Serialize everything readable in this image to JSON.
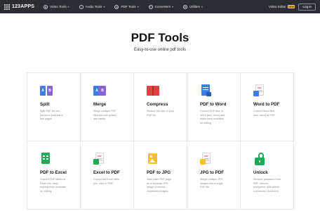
{
  "header": {
    "logo_text": "123APPS",
    "nav": [
      {
        "label": "Video Tools",
        "icon": "play-icon"
      },
      {
        "label": "Audio Tools",
        "icon": "music-icon"
      },
      {
        "label": "PDF Tools",
        "icon": "pdf-icon"
      },
      {
        "label": "Converters",
        "icon": "convert-icon"
      },
      {
        "label": "Utilities",
        "icon": "gear-icon"
      }
    ],
    "video_editor": "Video Editor",
    "new_badge": "NEW",
    "login": "Log in",
    "colors": {
      "bar": "#2b2d33",
      "badge": "#f4c531"
    }
  },
  "page": {
    "title": "PDF Tools",
    "subtitle": "Easy-to-use online pdf tools"
  },
  "tools": [
    {
      "name": "Split",
      "desc": "Split PDF file into pieces or pick just a few pages",
      "icon": "split-icon"
    },
    {
      "name": "Merge",
      "desc": "Merge multiple PDF files into one quickly and easily",
      "icon": "merge-icon"
    },
    {
      "name": "Compress",
      "desc": "Reduce the size of your PDF file",
      "icon": "compress-icon"
    },
    {
      "name": "PDF to Word",
      "desc": "Convert PDF files to Word (doc, docx) and make them available for editing",
      "icon": "pdf-to-word-icon"
    },
    {
      "name": "Word to PDF",
      "desc": "Convert Word files (doc, docx) to PDF",
      "icon": "word-to-pdf-icon"
    },
    {
      "name": "PDF to Excel",
      "desc": "Convert PDF tables to Excel (xls, xlsx), making them available for editing",
      "icon": "pdf-to-excel-icon"
    },
    {
      "name": "Excel to PDF",
      "desc": "Convert an Excel table (xls, xlsx) to PDF",
      "icon": "excel-to-pdf-icon"
    },
    {
      "name": "PDF to JPG",
      "desc": "Save each PDF page as a separate JPG image or extract embedded images",
      "icon": "pdf-to-jpg-icon"
    },
    {
      "name": "JPG to PDF",
      "desc": "Merge multiple JPG images into a single PDF file",
      "icon": "jpg-to-pdf-icon"
    },
    {
      "name": "Unlock",
      "desc": "Remove password from PDF, remove encryption, and unlock a protected document",
      "icon": "unlock-icon"
    }
  ],
  "icon_labels": {
    "split_a": "A",
    "split_b": "B",
    "merge_a": "A",
    "merge_b": "B",
    "pdf_tag": "PDF"
  }
}
